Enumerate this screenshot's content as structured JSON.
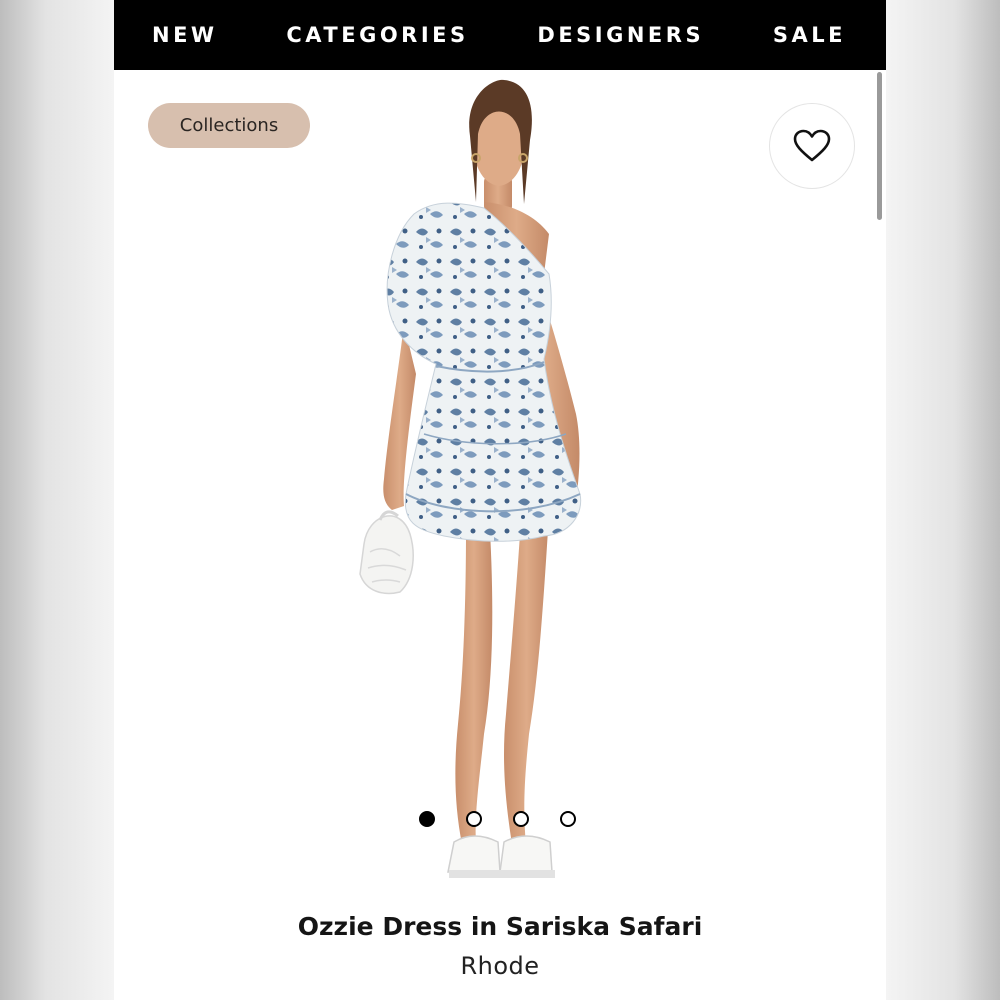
{
  "nav": {
    "items": [
      "NEW",
      "CATEGORIES",
      "DESIGNERS",
      "SALE"
    ]
  },
  "chip": {
    "label": "Collections"
  },
  "favorite": {
    "icon": "heart-outline-icon"
  },
  "carousel": {
    "slide_count": 4,
    "active_index": 0
  },
  "product": {
    "title": "Ozzie Dress in Sariska Safari",
    "brand": "Rhode"
  },
  "colors": {
    "nav_bg": "#000000",
    "chip_bg": "#d7bfae",
    "dress_base": "#eef2f4",
    "dress_print": "#5f7fa3"
  }
}
